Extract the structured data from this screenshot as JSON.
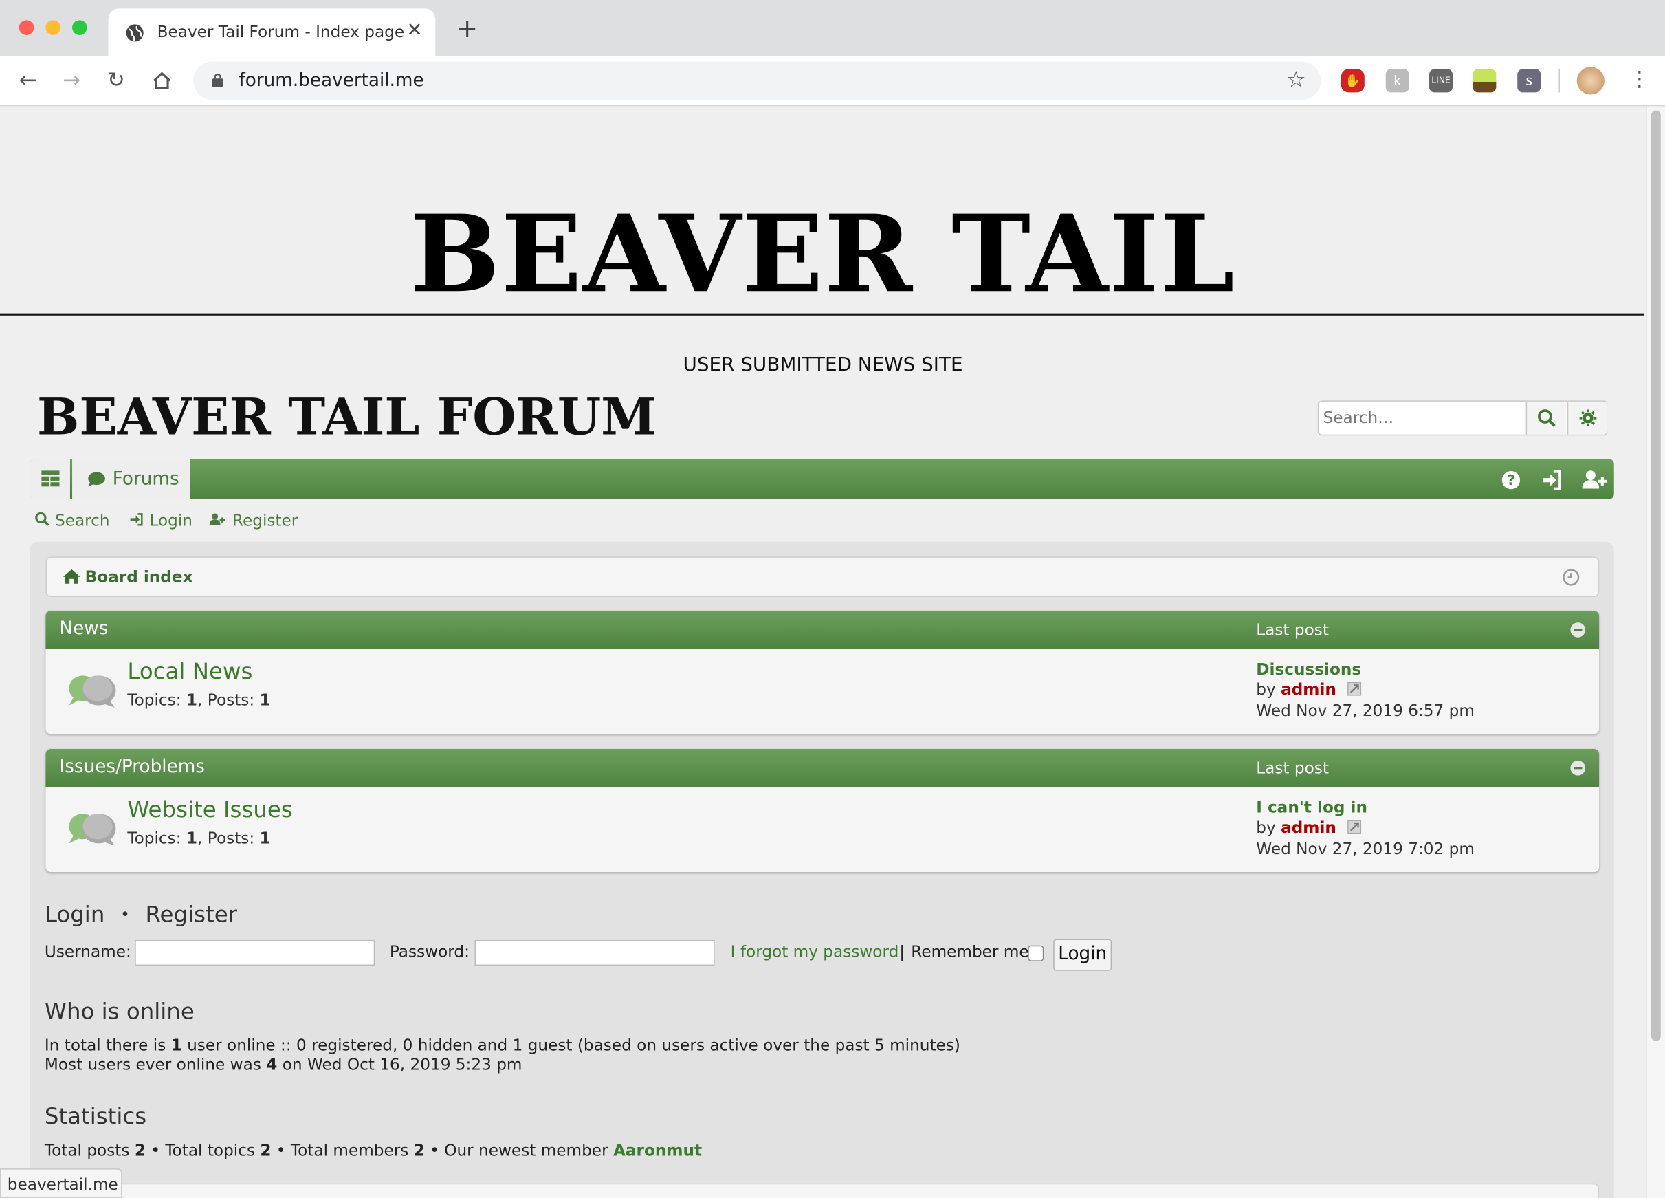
{
  "browser": {
    "tab_title": "Beaver Tail Forum - Index page",
    "new_tab": "+",
    "url": "forum.beavertail.me",
    "status_url": "beavertail.me",
    "ext_letters": [
      "k",
      "LINE",
      "s"
    ]
  },
  "site": {
    "banner": "BEAVER TAIL",
    "tagline": "USER SUBMITTED NEWS SITE",
    "forum_logo": "BEAVER TAIL FORUM"
  },
  "search": {
    "placeholder": "Search…"
  },
  "navbar": {
    "forums_label": "Forums"
  },
  "quicklinks": {
    "search": "Search",
    "login": "Login",
    "register": "Register"
  },
  "breadcrumb": {
    "board_index": "Board index"
  },
  "categories": [
    {
      "name": "News",
      "last_post_header": "Last post",
      "forum": {
        "title": "Local News",
        "topics_label": "Topics:",
        "topics": "1",
        "sep": ",",
        "posts_label": "Posts:",
        "posts": "1",
        "last_title": "Discussions",
        "by": "by",
        "author": "admin",
        "date": "Wed Nov 27, 2019 6:57 pm"
      }
    },
    {
      "name": "Issues/Problems",
      "last_post_header": "Last post",
      "forum": {
        "title": "Website Issues",
        "topics_label": "Topics:",
        "topics": "1",
        "sep": ",",
        "posts_label": "Posts:",
        "posts": "1",
        "last_title": "I can't log in",
        "by": "by",
        "author": "admin",
        "date": "Wed Nov 27, 2019 7:02 pm"
      }
    }
  ],
  "login": {
    "heading_login": "Login",
    "heading_dot": "•",
    "heading_register": "Register",
    "username_label": "Username:",
    "password_label": "Password:",
    "forgot": "I forgot my password",
    "pipe": "|",
    "remember": "Remember me",
    "button": "Login"
  },
  "online": {
    "heading": "Who is online",
    "line1_a": "In total there is ",
    "line1_count": "1",
    "line1_b": " user online :: 0 registered, 0 hidden and 1 guest (based on users active over the past 5 minutes)",
    "line2_a": "Most users ever online was ",
    "line2_count": "4",
    "line2_b": " on Wed Oct 16, 2019 5:23 pm"
  },
  "stats": {
    "heading": "Statistics",
    "posts_label": "Total posts ",
    "posts": "2",
    "topics_label": " • Total topics ",
    "topics": "2",
    "members_label": " • Total members ",
    "members": "2",
    "newest_label": " • Our newest member ",
    "newest": "Aaronmut"
  },
  "colors": {
    "forum_green": "#5a8f4a",
    "link_green": "#3d7a2e",
    "author_red": "#aa0000"
  }
}
